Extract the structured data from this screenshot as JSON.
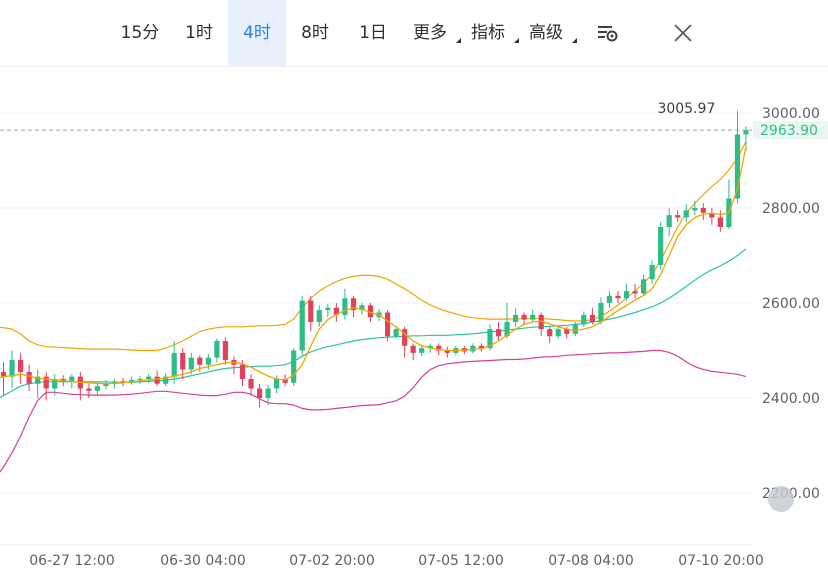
{
  "toolbar": {
    "intervals": [
      "15分",
      "1时",
      "4时",
      "8时",
      "1日"
    ],
    "active_interval": "4时",
    "more_label": "更多",
    "indicators_label": "指标",
    "advanced_label": "高级",
    "settings_icon": "chart-settings-icon",
    "close_icon": "close-icon"
  },
  "colors": {
    "up": "#2ebd85",
    "down": "#e0425b",
    "ma": "#f0a500",
    "boll_mid": "#29c3a4",
    "boll_low": "#d63f95",
    "accent": "#2f7de1"
  },
  "chart_data": {
    "type": "candlestick",
    "title": "",
    "y_ticks": [
      "3000.00",
      "2800.00",
      "2600.00",
      "2400.00",
      "2200.00"
    ],
    "x_ticks": [
      "06-27 12:00",
      "06-30 04:00",
      "07-02 20:00",
      "07-05 12:00",
      "07-08 04:00",
      "07-10 20:00"
    ],
    "high_label": "3005.97",
    "last_price": "2963.90",
    "ylim": [
      2150,
      3040
    ],
    "candles": [
      [
        2415,
        2455,
        2390,
        2480
      ],
      [
        2455,
        2445,
        2405,
        2475
      ],
      [
        2445,
        2480,
        2420,
        2500
      ],
      [
        2480,
        2455,
        2430,
        2495
      ],
      [
        2455,
        2430,
        2415,
        2470
      ],
      [
        2430,
        2445,
        2400,
        2460
      ],
      [
        2445,
        2420,
        2395,
        2455
      ],
      [
        2420,
        2440,
        2405,
        2450
      ],
      [
        2440,
        2435,
        2425,
        2448
      ],
      [
        2435,
        2445,
        2420,
        2450
      ],
      [
        2445,
        2420,
        2395,
        2455
      ],
      [
        2420,
        2415,
        2400,
        2430
      ],
      [
        2415,
        2425,
        2405,
        2432
      ],
      [
        2425,
        2430,
        2418,
        2438
      ],
      [
        2430,
        2435,
        2420,
        2440
      ],
      [
        2435,
        2432,
        2425,
        2442
      ],
      [
        2432,
        2438,
        2428,
        2445
      ],
      [
        2438,
        2440,
        2430,
        2446
      ],
      [
        2440,
        2445,
        2432,
        2450
      ],
      [
        2445,
        2430,
        2425,
        2458
      ],
      [
        2430,
        2445,
        2425,
        2452
      ],
      [
        2445,
        2495,
        2430,
        2520
      ],
      [
        2495,
        2460,
        2440,
        2505
      ],
      [
        2460,
        2485,
        2450,
        2495
      ],
      [
        2485,
        2470,
        2455,
        2490
      ],
      [
        2470,
        2485,
        2460,
        2493
      ],
      [
        2485,
        2520,
        2475,
        2525
      ],
      [
        2520,
        2480,
        2470,
        2528
      ],
      [
        2480,
        2470,
        2450,
        2488
      ],
      [
        2470,
        2440,
        2425,
        2480
      ],
      [
        2440,
        2420,
        2405,
        2450
      ],
      [
        2420,
        2400,
        2380,
        2430
      ],
      [
        2400,
        2420,
        2385,
        2428
      ],
      [
        2420,
        2440,
        2410,
        2448
      ],
      [
        2440,
        2432,
        2425,
        2450
      ],
      [
        2432,
        2500,
        2425,
        2505
      ],
      [
        2500,
        2605,
        2490,
        2615
      ],
      [
        2605,
        2560,
        2540,
        2615
      ],
      [
        2560,
        2585,
        2550,
        2595
      ],
      [
        2585,
        2590,
        2570,
        2598
      ],
      [
        2590,
        2575,
        2560,
        2600
      ],
      [
        2575,
        2610,
        2565,
        2630
      ],
      [
        2610,
        2585,
        2570,
        2615
      ],
      [
        2585,
        2595,
        2575,
        2600
      ],
      [
        2595,
        2570,
        2560,
        2600
      ],
      [
        2570,
        2580,
        2562,
        2588
      ],
      [
        2580,
        2530,
        2520,
        2585
      ],
      [
        2530,
        2545,
        2525,
        2550
      ],
      [
        2545,
        2510,
        2485,
        2550
      ],
      [
        2510,
        2495,
        2480,
        2515
      ],
      [
        2495,
        2505,
        2488,
        2510
      ],
      [
        2505,
        2510,
        2495,
        2515
      ],
      [
        2510,
        2500,
        2490,
        2515
      ],
      [
        2500,
        2495,
        2485,
        2508
      ],
      [
        2495,
        2505,
        2490,
        2510
      ],
      [
        2505,
        2498,
        2492,
        2510
      ],
      [
        2498,
        2510,
        2494,
        2515
      ],
      [
        2510,
        2505,
        2498,
        2515
      ],
      [
        2505,
        2545,
        2500,
        2555
      ],
      [
        2545,
        2530,
        2520,
        2560
      ],
      [
        2530,
        2560,
        2525,
        2600
      ],
      [
        2560,
        2575,
        2550,
        2590
      ],
      [
        2575,
        2565,
        2555,
        2580
      ],
      [
        2565,
        2575,
        2560,
        2585
      ],
      [
        2575,
        2545,
        2530,
        2580
      ],
      [
        2545,
        2530,
        2515,
        2550
      ],
      [
        2530,
        2545,
        2525,
        2552
      ],
      [
        2545,
        2535,
        2525,
        2550
      ],
      [
        2535,
        2555,
        2530,
        2560
      ],
      [
        2555,
        2575,
        2550,
        2582
      ],
      [
        2575,
        2560,
        2555,
        2590
      ],
      [
        2560,
        2600,
        2555,
        2612
      ],
      [
        2600,
        2615,
        2590,
        2625
      ],
      [
        2615,
        2610,
        2600,
        2625
      ],
      [
        2610,
        2625,
        2605,
        2640
      ],
      [
        2625,
        2620,
        2610,
        2640
      ],
      [
        2620,
        2650,
        2615,
        2660
      ],
      [
        2650,
        2680,
        2640,
        2690
      ],
      [
        2680,
        2760,
        2670,
        2770
      ],
      [
        2760,
        2785,
        2740,
        2800
      ],
      [
        2785,
        2780,
        2770,
        2795
      ],
      [
        2780,
        2795,
        2770,
        2808
      ],
      [
        2795,
        2800,
        2785,
        2815
      ],
      [
        2800,
        2790,
        2775,
        2810
      ],
      [
        2790,
        2780,
        2765,
        2800
      ],
      [
        2780,
        2760,
        2750,
        2795
      ],
      [
        2760,
        2820,
        2755,
        2860
      ],
      [
        2820,
        2955,
        2810,
        3005
      ],
      [
        2955,
        2964,
        2920,
        2972
      ]
    ],
    "ma_line": [
      2440,
      2445,
      2447,
      2450,
      2446,
      2442,
      2440,
      2438,
      2436,
      2435,
      2433,
      2432,
      2431,
      2430,
      2431,
      2432,
      2434,
      2436,
      2438,
      2440,
      2442,
      2446,
      2450,
      2455,
      2462,
      2466,
      2470,
      2474,
      2475,
      2472,
      2465,
      2455,
      2446,
      2440,
      2438,
      2448,
      2470,
      2510,
      2545,
      2565,
      2576,
      2584,
      2590,
      2587,
      2580,
      2575,
      2562,
      2550,
      2535,
      2520,
      2510,
      2505,
      2502,
      2500,
      2500,
      2501,
      2502,
      2504,
      2510,
      2520,
      2532,
      2545,
      2555,
      2560,
      2562,
      2556,
      2550,
      2545,
      2542,
      2545,
      2550,
      2560,
      2572,
      2584,
      2595,
      2606,
      2616,
      2630,
      2660,
      2700,
      2740,
      2765,
      2780,
      2787,
      2789,
      2786,
      2790,
      2840,
      2930
    ],
    "boll_upper": [
      2550,
      2548,
      2545,
      2535,
      2520,
      2512,
      2508,
      2507,
      2506,
      2505,
      2504,
      2503,
      2503,
      2503,
      2503,
      2502,
      2501,
      2500,
      2500,
      2500,
      2505,
      2512,
      2520,
      2530,
      2540,
      2545,
      2548,
      2550,
      2550,
      2550,
      2551,
      2552,
      2552,
      2553,
      2555,
      2566,
      2590,
      2610,
      2625,
      2636,
      2645,
      2652,
      2656,
      2658,
      2658,
      2656,
      2650,
      2640,
      2630,
      2618,
      2606,
      2596,
      2588,
      2582,
      2577,
      2572,
      2569,
      2567,
      2566,
      2566,
      2566,
      2567,
      2567,
      2567,
      2567,
      2566,
      2565,
      2563,
      2562,
      2562,
      2565,
      2572,
      2583,
      2596,
      2610,
      2625,
      2642,
      2660,
      2690,
      2725,
      2760,
      2790,
      2810,
      2828,
      2845,
      2860,
      2880,
      2905,
      2940
    ],
    "boll_mid": [
      2395,
      2405,
      2415,
      2425,
      2430,
      2433,
      2434,
      2434,
      2434,
      2434,
      2434,
      2434,
      2434,
      2434,
      2433,
      2433,
      2433,
      2434,
      2435,
      2436,
      2437,
      2440,
      2443,
      2447,
      2451,
      2455,
      2459,
      2462,
      2464,
      2465,
      2466,
      2467,
      2467,
      2468,
      2470,
      2477,
      2488,
      2497,
      2503,
      2508,
      2512,
      2516,
      2520,
      2523,
      2525,
      2527,
      2528,
      2529,
      2530,
      2531,
      2531,
      2532,
      2532,
      2532,
      2533,
      2534,
      2535,
      2537,
      2539,
      2541,
      2543,
      2545,
      2547,
      2549,
      2550,
      2551,
      2552,
      2553,
      2555,
      2557,
      2560,
      2563,
      2566,
      2570,
      2575,
      2580,
      2586,
      2592,
      2600,
      2610,
      2622,
      2635,
      2648,
      2660,
      2670,
      2678,
      2688,
      2700,
      2714
    ],
    "boll_lower": [
      2230,
      2255,
      2285,
      2320,
      2360,
      2395,
      2412,
      2412,
      2410,
      2408,
      2407,
      2406,
      2406,
      2406,
      2406,
      2407,
      2408,
      2410,
      2412,
      2414,
      2414,
      2412,
      2410,
      2408,
      2406,
      2405,
      2405,
      2408,
      2412,
      2412,
      2408,
      2398,
      2390,
      2388,
      2388,
      2385,
      2378,
      2375,
      2375,
      2376,
      2378,
      2380,
      2382,
      2384,
      2385,
      2386,
      2390,
      2394,
      2404,
      2422,
      2444,
      2460,
      2468,
      2472,
      2474,
      2476,
      2477,
      2478,
      2479,
      2480,
      2481,
      2481,
      2482,
      2484,
      2486,
      2487,
      2488,
      2490,
      2491,
      2492,
      2493,
      2494,
      2495,
      2495,
      2496,
      2497,
      2498,
      2500,
      2500,
      2496,
      2488,
      2476,
      2466,
      2460,
      2456,
      2454,
      2452,
      2450,
      2445
    ]
  }
}
